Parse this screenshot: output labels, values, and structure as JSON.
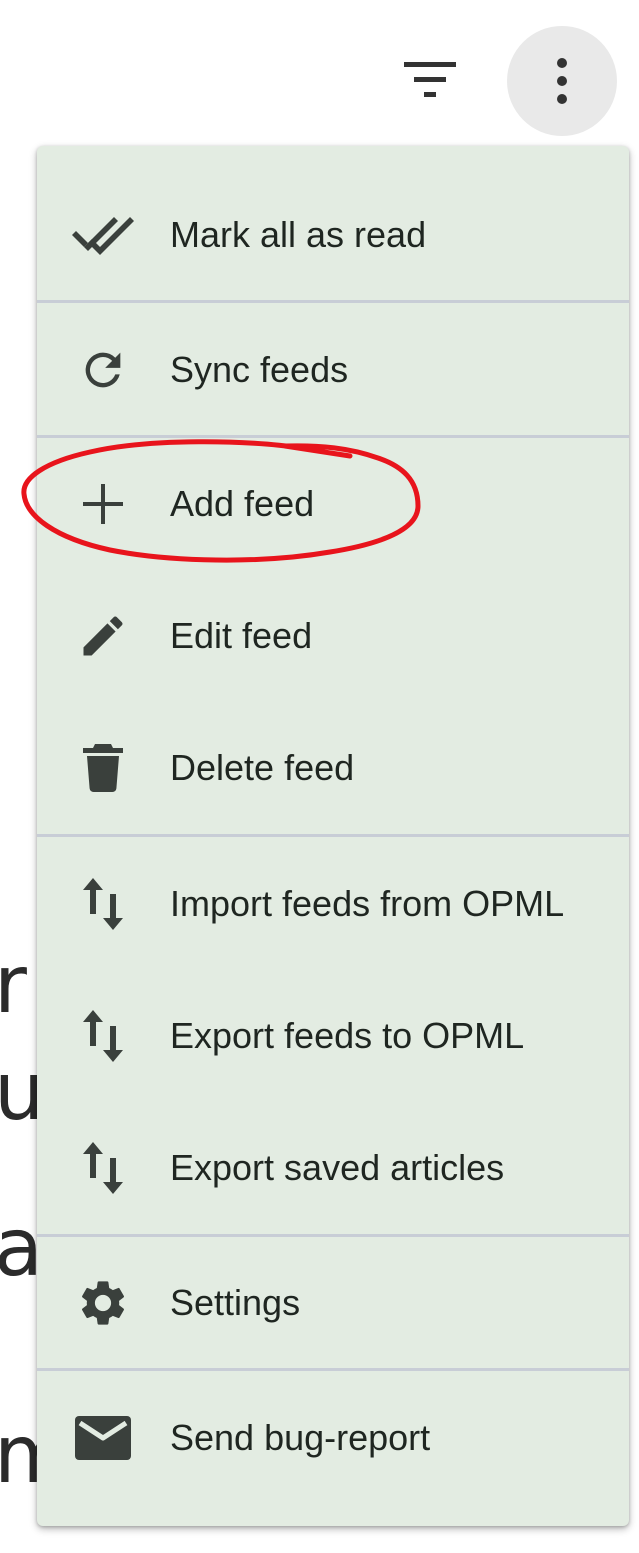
{
  "background": {
    "text_fragments": [
      "r",
      "u",
      "ar",
      "m"
    ]
  },
  "toolbar": {
    "filter_icon": "filter-list-icon",
    "more_icon": "more-vert-icon"
  },
  "menu": {
    "items": [
      {
        "label": "Mark all as read",
        "icon": "done-all-icon"
      },
      {
        "label": "Sync feeds",
        "icon": "refresh-icon"
      },
      {
        "label": "Add feed",
        "icon": "add-icon"
      },
      {
        "label": "Edit feed",
        "icon": "edit-pencil-icon"
      },
      {
        "label": "Delete feed",
        "icon": "trash-icon"
      },
      {
        "label": "Import feeds from OPML",
        "icon": "swap-vert-icon"
      },
      {
        "label": "Export feeds to OPML",
        "icon": "swap-vert-icon"
      },
      {
        "label": "Export saved articles",
        "icon": "swap-vert-icon"
      },
      {
        "label": "Settings",
        "icon": "gear-icon"
      },
      {
        "label": "Send bug-report",
        "icon": "mail-icon"
      }
    ]
  },
  "colors": {
    "menu_background": "#e3ece2",
    "icon": "#3a403c",
    "label": "#1f2621",
    "divider": "#c8cdd6",
    "annotation": "#e8141c"
  }
}
